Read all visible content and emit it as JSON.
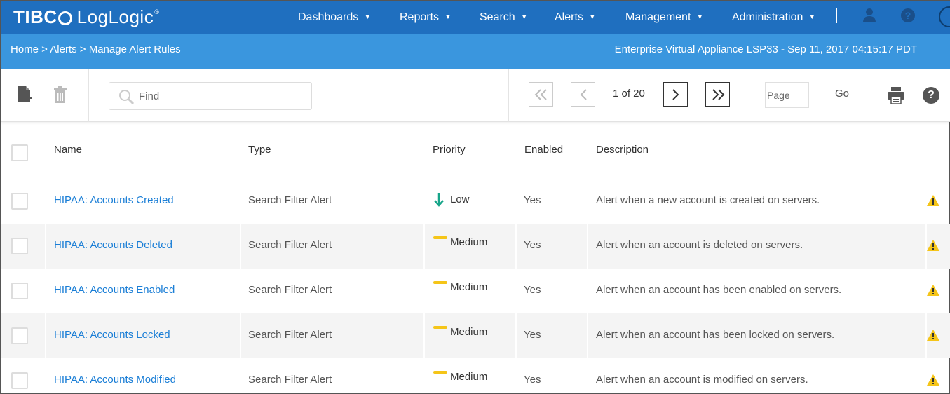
{
  "app": {
    "logo_brand": "TIBC",
    "logo_product": "LogLogic"
  },
  "nav": {
    "items": [
      {
        "label": "Dashboards"
      },
      {
        "label": "Reports"
      },
      {
        "label": "Search"
      },
      {
        "label": "Alerts"
      },
      {
        "label": "Management"
      },
      {
        "label": "Administration"
      }
    ],
    "user_icon": "user-icon",
    "help_icon": "help-icon"
  },
  "breadcrumb": {
    "text": "Home > Alerts > Manage Alert Rules",
    "appliance_info": "Enterprise Virtual Appliance LSP33 - Sep 11, 2017 04:15:17 PDT"
  },
  "toolbar": {
    "new_icon": "new-file-icon",
    "delete_icon": "trash-icon",
    "find_placeholder": "Find",
    "find_value": "",
    "page_status": "1 of 20",
    "page_input_placeholder": "Page",
    "go_label": "Go",
    "print_icon": "print-icon",
    "help_icon": "help-icon"
  },
  "table": {
    "columns": {
      "name": "Name",
      "type": "Type",
      "priority": "Priority",
      "enabled": "Enabled",
      "description": "Description"
    },
    "rows": [
      {
        "name": "HIPAA: Accounts Created",
        "type": "Search Filter Alert",
        "priority": "Low",
        "priority_icon": "down-arrow-icon",
        "enabled": "Yes",
        "description": "Alert when a new account is created on servers."
      },
      {
        "name": "HIPAA: Accounts Deleted",
        "type": "Search Filter Alert",
        "priority": "Medium",
        "priority_icon": "dash-icon",
        "enabled": "Yes",
        "description": "Alert when an account is deleted on servers."
      },
      {
        "name": "HIPAA: Accounts Enabled",
        "type": "Search Filter Alert",
        "priority": "Medium",
        "priority_icon": "dash-icon",
        "enabled": "Yes",
        "description": "Alert when an account has been enabled on servers."
      },
      {
        "name": "HIPAA: Accounts Locked",
        "type": "Search Filter Alert",
        "priority": "Medium",
        "priority_icon": "dash-icon",
        "enabled": "Yes",
        "description": "Alert when an account has been locked on servers."
      },
      {
        "name": "HIPAA: Accounts Modified",
        "type": "Search Filter Alert",
        "priority": "Medium",
        "priority_icon": "dash-icon",
        "enabled": "Yes",
        "description": "Alert when an account is modified on servers."
      }
    ]
  },
  "colors": {
    "nav_bg": "#1f6fbf",
    "breadcrumb_bg": "#3a96de",
    "link": "#1a7ed6",
    "low_arrow": "#17a589",
    "medium_dash": "#f5c518",
    "warning": "#f5c518"
  }
}
